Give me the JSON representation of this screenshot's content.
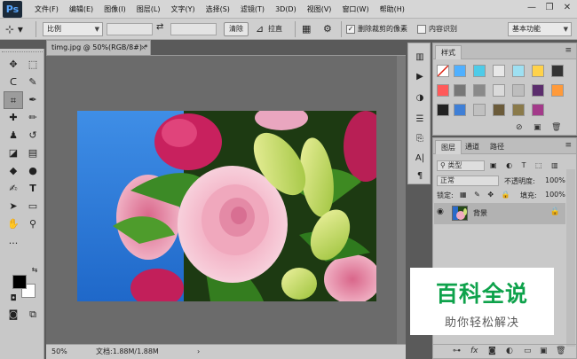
{
  "app": {
    "logo": "Ps"
  },
  "menu": [
    "文件(F)",
    "编辑(E)",
    "图像(I)",
    "图层(L)",
    "文字(Y)",
    "选择(S)",
    "滤镜(T)",
    "3D(D)",
    "视图(V)",
    "窗口(W)",
    "帮助(H)"
  ],
  "window_controls": {
    "minimize": "—",
    "restore": "❐",
    "close": "✕"
  },
  "options": {
    "tool_glyph": "⌗",
    "ratio_select": "比例",
    "clear_button": "清除",
    "straighten_label": "拉直",
    "delete_cropped_label": "删除裁剪的像素",
    "delete_cropped_checked": true,
    "content_aware_label": "内容识别",
    "content_aware_checked": false,
    "workspace_select": "基本功能"
  },
  "toolbar": {
    "tools": [
      "move",
      "marquee",
      "lasso",
      "quick-select",
      "crop",
      "eyedropper",
      "healing",
      "brush",
      "stamp",
      "history-brush",
      "eraser",
      "gradient",
      "blur",
      "dodge",
      "pen",
      "type",
      "path-select",
      "shape",
      "hand",
      "zoom",
      "more",
      "quick-mask",
      "screen-mode"
    ],
    "foreground_color": "#000000",
    "background_color": "#ffffff"
  },
  "document": {
    "tab_title": "timg.jpg @ 50%(RGB/8#) *",
    "zoom": "50%",
    "doc_size": "文档:1.88M/1.88M",
    "status_arrow": "›"
  },
  "styles_panel": {
    "tab": "样式",
    "swatches": [
      "#ffffff",
      "#4fb0ff",
      "#4ecbe8",
      "#e8e8e8",
      "#9ee0f2",
      "#ffd24a",
      "#333333",
      "#ff5a5a",
      "#777777",
      "#8a8a8a",
      "#dadada",
      "#5b2d6d",
      "#ff9a3a",
      "#3d3d3d",
      "#222222",
      "#3f7fd6",
      "#c0c0c0",
      "#6b5b3a",
      "#8a7a4a",
      "#a33a8a"
    ]
  },
  "layers_panel": {
    "tabs": [
      "图层",
      "通道",
      "路径"
    ],
    "kind_filter": "类型",
    "blend_mode": "正常",
    "opacity_label": "不透明度:",
    "opacity_value": "100%",
    "lock_label": "锁定:",
    "fill_label": "填充:",
    "fill_value": "100%",
    "layer_name": "背景"
  },
  "watermark": {
    "title": "百科全说",
    "subtitle": "助你轻松解决",
    "title_color": "#0ea24b"
  }
}
